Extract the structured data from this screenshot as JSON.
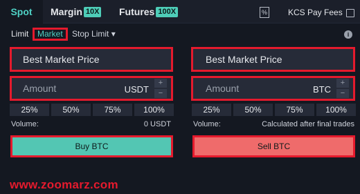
{
  "tabs": {
    "spot": "Spot",
    "margin": "Margin",
    "margin_badge": "10X",
    "futures": "Futures",
    "futures_badge": "100X"
  },
  "header": {
    "percent_icon": "%",
    "fees_label": "KCS Pay Fees",
    "fees_checked": false
  },
  "order_type": {
    "limit": "Limit",
    "market": "Market",
    "stop_limit": "Stop Limit ▾",
    "selected": "Market"
  },
  "buy": {
    "price_placeholder": "Best Market Price",
    "amount_placeholder": "Amount",
    "unit": "USDT",
    "percents": [
      "25%",
      "50%",
      "75%",
      "100%"
    ],
    "volume_label": "Volume:",
    "volume_value": "0 USDT",
    "button_label": "Buy BTC"
  },
  "sell": {
    "price_placeholder": "Best Market Price",
    "amount_placeholder": "Amount",
    "unit": "BTC",
    "percents": [
      "25%",
      "50%",
      "75%",
      "100%"
    ],
    "volume_label": "Volume:",
    "volume_value": "Calculated after final trades",
    "button_label": "Sell BTC"
  },
  "watermark": "www.zoomarz.com",
  "colors": {
    "accent": "#4fd1c5",
    "buy": "#53c6b3",
    "sell": "#ef6b6b",
    "highlight": "#e51a2d",
    "background": "#141821"
  }
}
